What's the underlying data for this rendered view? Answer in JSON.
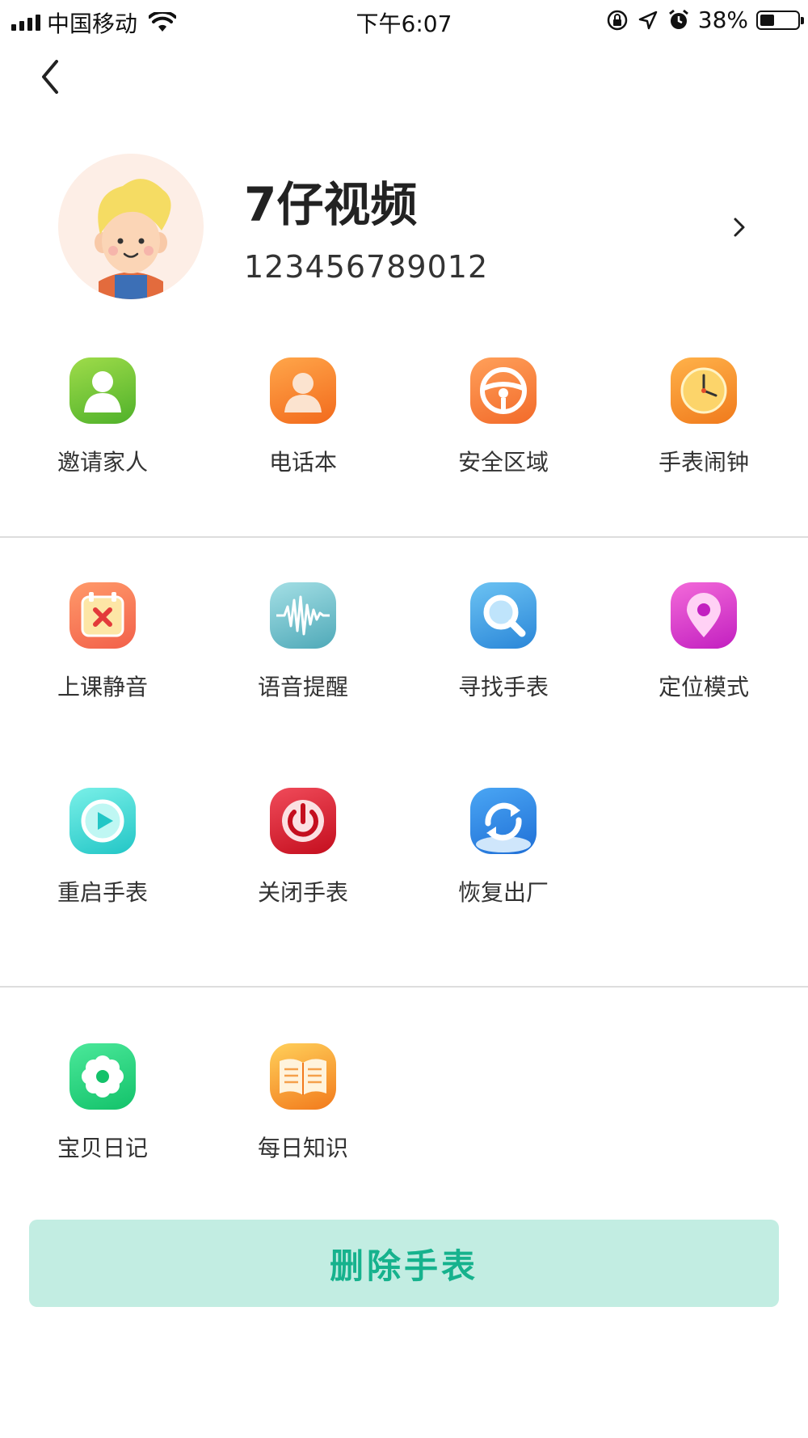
{
  "status_bar": {
    "carrier": "中国移动",
    "time": "下午6:07",
    "battery_percent": "38%",
    "battery_level": 0.38
  },
  "profile": {
    "name": "7仔视频",
    "id": "123456789012"
  },
  "functions": [
    {
      "label": "邀请家人",
      "icon": "invite-family-icon"
    },
    {
      "label": "电话本",
      "icon": "phonebook-icon"
    },
    {
      "label": "安全区域",
      "icon": "safe-zone-icon"
    },
    {
      "label": "手表闹钟",
      "icon": "watch-alarm-icon"
    },
    {
      "label": "上课静音",
      "icon": "class-mute-icon"
    },
    {
      "label": "语音提醒",
      "icon": "voice-reminder-icon"
    },
    {
      "label": "寻找手表",
      "icon": "find-watch-icon"
    },
    {
      "label": "定位模式",
      "icon": "location-mode-icon"
    },
    {
      "label": "重启手表",
      "icon": "restart-watch-icon"
    },
    {
      "label": "关闭手表",
      "icon": "power-off-icon"
    },
    {
      "label": "恢复出厂",
      "icon": "factory-reset-icon"
    },
    {
      "label": "宝贝日记",
      "icon": "baby-diary-icon"
    },
    {
      "label": "每日知识",
      "icon": "daily-knowledge-icon"
    }
  ],
  "delete_button": {
    "label": "删除手表"
  },
  "colors": {
    "accent": "#16b28d",
    "button_bg": "#c2ede2",
    "divider": "#dddddd"
  }
}
